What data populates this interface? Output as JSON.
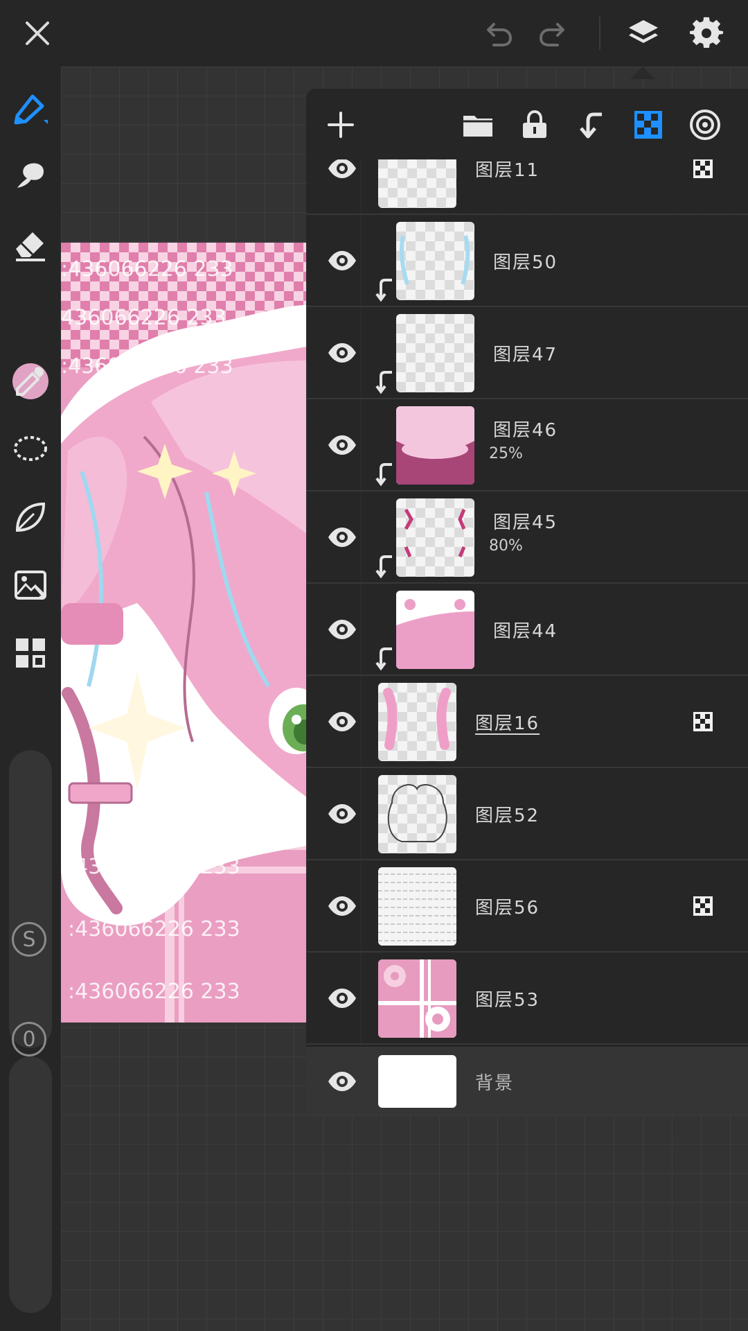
{
  "top_bar": {
    "close_icon": "close-icon",
    "undo_icon": "undo-icon",
    "redo_icon": "redo-icon",
    "layers_icon": "layers-icon",
    "settings_icon": "gear-icon"
  },
  "toolbar": {
    "tools": [
      "brush-icon",
      "smudge-icon",
      "eraser-icon",
      "color-swatch",
      "eyedropper-icon",
      "lasso-icon",
      "leaf-icon",
      "import-image-icon",
      "gallery-grid-icon"
    ],
    "current_color": "#e0a3c4",
    "size_slider_label": "S",
    "opacity_slider_label": "0"
  },
  "layers_panel": {
    "toolbar_icons": [
      "add-icon",
      "folder-icon",
      "lock-icon",
      "clip-icon",
      "alpha-lock-icon",
      "reference-icon"
    ],
    "accent": "#1e90ff",
    "layers": [
      {
        "name": "图层11",
        "opacity": "",
        "clipped": false,
        "alpha_locked": true
      },
      {
        "name": "图层50",
        "opacity": "",
        "clipped": true,
        "alpha_locked": false
      },
      {
        "name": "图层47",
        "opacity": "",
        "clipped": true,
        "alpha_locked": false
      },
      {
        "name": "图层46",
        "opacity": "25%",
        "clipped": true,
        "alpha_locked": false
      },
      {
        "name": "图层45",
        "opacity": "80%",
        "clipped": true,
        "alpha_locked": false
      },
      {
        "name": "图层44",
        "opacity": "",
        "clipped": true,
        "alpha_locked": false
      },
      {
        "name": "图层16",
        "opacity": "",
        "clipped": false,
        "alpha_locked": true,
        "selected": true
      },
      {
        "name": "图层52",
        "opacity": "",
        "clipped": false,
        "alpha_locked": false
      },
      {
        "name": "图层56",
        "opacity": "",
        "clipped": false,
        "alpha_locked": true
      },
      {
        "name": "图层53",
        "opacity": "",
        "clipped": false,
        "alpha_locked": false
      }
    ],
    "background_layer": {
      "name": "背景"
    }
  },
  "artwork": {
    "watermark_text": ":436066226 233"
  }
}
